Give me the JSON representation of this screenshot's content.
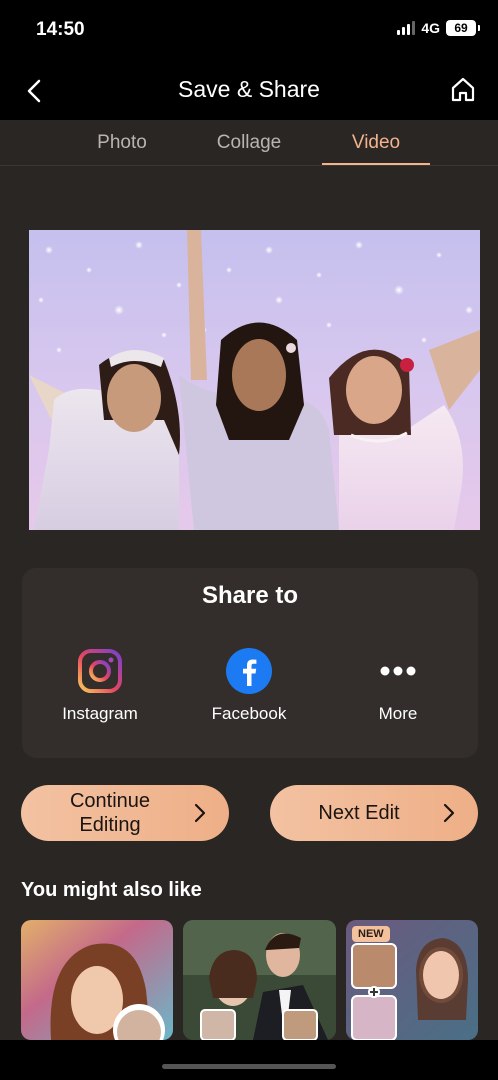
{
  "status": {
    "time": "14:50",
    "network": "4G",
    "battery": "69"
  },
  "nav": {
    "title": "Save & Share"
  },
  "tabs": [
    {
      "label": "Photo"
    },
    {
      "label": "Collage"
    },
    {
      "label": "Video"
    }
  ],
  "active_tab": "Video",
  "share": {
    "title": "Share to",
    "items": [
      {
        "label": "Instagram",
        "icon": "instagram-icon"
      },
      {
        "label": "Facebook",
        "icon": "facebook-icon"
      },
      {
        "label": "More",
        "icon": "more-icon"
      }
    ]
  },
  "buttons": {
    "continue_line1": "Continue",
    "continue_line2": "Editing",
    "next_edit": "Next Edit"
  },
  "suggestions": {
    "title": "You might also like",
    "new_badge": "NEW"
  },
  "colors": {
    "accent": "#f2b38e",
    "button_gradient_start": "#f3c2a2",
    "button_gradient_end": "#eeaf87",
    "background": "#2a2624"
  }
}
